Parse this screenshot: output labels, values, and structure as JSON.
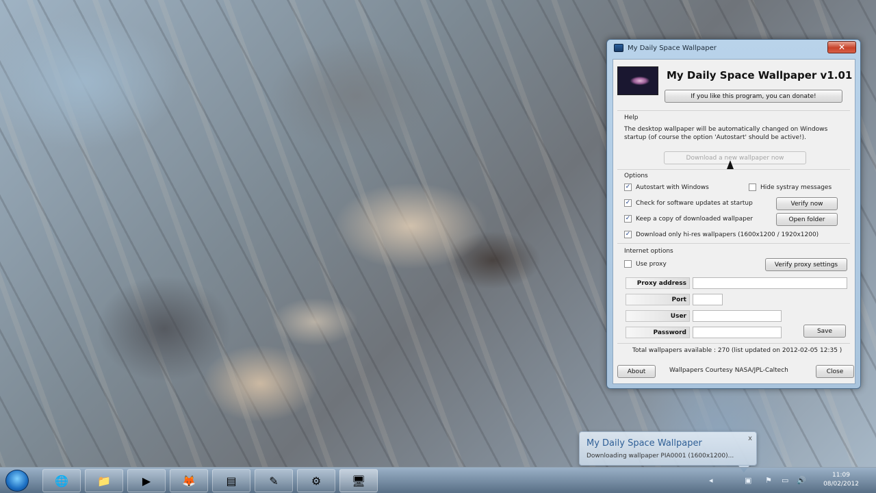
{
  "window": {
    "title": "My Daily Space Wallpaper",
    "close_glyph": "✕"
  },
  "header": {
    "app_name": "My Daily Space Wallpaper v1.01",
    "donate_label": "If you like this program, you can donate!"
  },
  "help": {
    "label": "Help",
    "text": "The desktop wallpaper will be automatically changed on Windows startup (of course the option 'Autostart' should be active!).",
    "download_now_label": "Download a new wallpaper now"
  },
  "options": {
    "label": "Options",
    "autostart": {
      "label": "Autostart with Windows",
      "checked": true
    },
    "hide_systray": {
      "label": "Hide systray messages",
      "checked": false
    },
    "check_updates": {
      "label": "Check for software updates at startup",
      "checked": true
    },
    "keep_copy": {
      "label": "Keep a copy of downloaded wallpaper",
      "checked": true
    },
    "hires_only": {
      "label": "Download only hi-res wallpapers (1600x1200 / 1920x1200)",
      "checked": true
    },
    "verify_now_label": "Verify now",
    "open_folder_label": "Open folder"
  },
  "internet": {
    "label": "Internet options",
    "use_proxy": {
      "label": "Use proxy",
      "checked": false
    },
    "verify_proxy_label": "Verify proxy settings",
    "proxy_address_label": "Proxy address",
    "port_label": "Port",
    "user_label": "User",
    "password_label": "Password",
    "proxy_address_value": "",
    "port_value": "",
    "user_value": "",
    "password_value": "",
    "save_label": "Save"
  },
  "footer": {
    "status": "Total wallpapers available : 270 (list updated on 2012-02-05 12:35 )",
    "about_label": "About",
    "credits": "Wallpapers Courtesy NASA/JPL-Caltech",
    "close_label": "Close"
  },
  "notification": {
    "title": "My Daily Space Wallpaper",
    "text": "Downloading wallpaper PIA0001 (1600x1200)...",
    "close_glyph": "x"
  },
  "taskbar": {
    "time": "11:09",
    "date": "08/02/2012",
    "buttons": [
      "internet-explorer-icon",
      "folder-icon",
      "media-player-icon",
      "firefox-icon",
      "archive-icon",
      "notes-icon",
      "tool-icon",
      "monitor-icon"
    ]
  }
}
